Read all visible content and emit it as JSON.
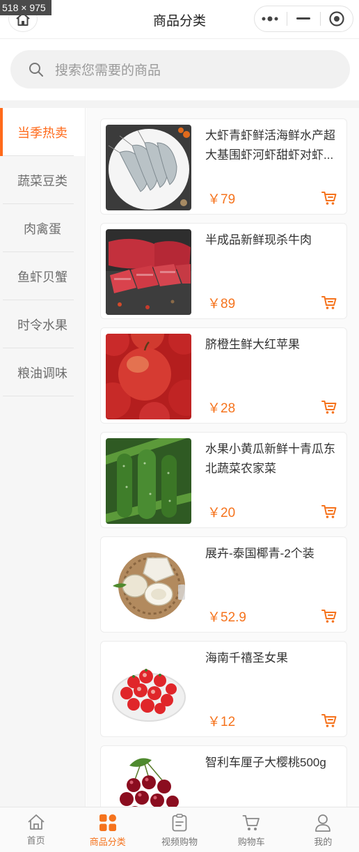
{
  "dim_badge": "518 × 975",
  "header": {
    "title": "商品分类"
  },
  "search": {
    "placeholder": "搜索您需要的商品"
  },
  "categories": [
    {
      "label": "当季热卖",
      "active": true
    },
    {
      "label": "蔬菜豆类",
      "active": false
    },
    {
      "label": "肉禽蛋",
      "active": false
    },
    {
      "label": "鱼虾贝蟹",
      "active": false
    },
    {
      "label": "时令水果",
      "active": false
    },
    {
      "label": "粮油调味",
      "active": false
    }
  ],
  "products": [
    {
      "name": "大虾青虾鲜活海鲜水产超大基围虾河虾甜虾对虾...",
      "price": "￥79",
      "image": "shrimp-plate"
    },
    {
      "name": "半成品新鲜现杀牛肉",
      "price": "￥89",
      "image": "beef-steaks"
    },
    {
      "name": "脐橙生鲜大红苹果",
      "price": "￥28",
      "image": "red-apples"
    },
    {
      "name": "水果小黄瓜新鲜十青瓜东北蔬菜农家菜",
      "price": "￥20",
      "image": "cucumbers"
    },
    {
      "name": "展卉-泰国椰青-2个装",
      "price": "￥52.9",
      "image": "young-coconuts"
    },
    {
      "name": "海南千禧圣女果",
      "price": "￥12",
      "image": "cherry-tomatoes"
    },
    {
      "name": "智利车厘子大樱桃500g",
      "price": "",
      "image": "cherries"
    }
  ],
  "tabbar": [
    {
      "label": "首页",
      "icon": "home-icon",
      "active": false
    },
    {
      "label": "商品分类",
      "icon": "category-grid-icon",
      "active": true
    },
    {
      "label": "视频购物",
      "icon": "video-list-icon",
      "active": false
    },
    {
      "label": "购物车",
      "icon": "cart-icon",
      "active": false
    },
    {
      "label": "我的",
      "icon": "user-icon",
      "active": false
    }
  ],
  "colors": {
    "accent": "#f5731d",
    "sidebar_bg": "#f6f6f6",
    "search_bg": "#f1f1f1"
  }
}
